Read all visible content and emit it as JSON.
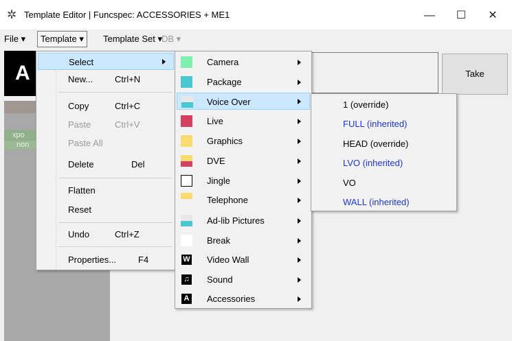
{
  "window": {
    "title": "Template Editor | Funcspec: ACCESSORIES + ME1",
    "icon": "gear-flower-icon",
    "controls": [
      "—",
      "☐",
      "✕"
    ]
  },
  "menubar": {
    "file": "File",
    "template": "Template",
    "template_set": "Template Set",
    "db": "DB"
  },
  "app": {
    "preview_letter": "A",
    "take_label": "Take",
    "row_labels": [
      "xpo",
      "non"
    ]
  },
  "template_menu": {
    "items": [
      {
        "label": "Select",
        "shortcut": "",
        "disabled": false,
        "submenu": true
      },
      {
        "label": "New...",
        "shortcut": "Ctrl+N",
        "disabled": false
      },
      {
        "label": "Copy",
        "shortcut": "Ctrl+C",
        "disabled": false
      },
      {
        "label": "Paste",
        "shortcut": "Ctrl+V",
        "disabled": true
      },
      {
        "label": "Paste All",
        "shortcut": "",
        "disabled": true
      },
      {
        "label": "Delete",
        "shortcut": "Del",
        "disabled": false
      },
      {
        "label": "Flatten",
        "shortcut": "",
        "disabled": false
      },
      {
        "label": "Reset",
        "shortcut": "",
        "disabled": false
      },
      {
        "label": "Undo",
        "shortcut": "Ctrl+Z",
        "disabled": false
      },
      {
        "label": "Properties...",
        "shortcut": "F4",
        "disabled": false
      }
    ]
  },
  "select_menu": {
    "items": [
      {
        "label": "Camera",
        "colors": [
          "#7ef0b0",
          "#7ef0b0"
        ]
      },
      {
        "label": "Package",
        "colors": [
          "#49c8d2",
          "#49c8d2"
        ]
      },
      {
        "label": "Voice Over",
        "colors": [
          "#e8e8e8",
          "#49c8d2"
        ]
      },
      {
        "label": "Live",
        "colors": [
          "#d64060",
          "#d64060"
        ]
      },
      {
        "label": "Graphics",
        "colors": [
          "#f8dc70",
          "#f8dc70"
        ]
      },
      {
        "label": "DVE",
        "colors": [
          "#f8dc70",
          "#d64060"
        ]
      },
      {
        "label": "Jingle",
        "colors": [
          "#ffffff",
          "#ffffff"
        ]
      },
      {
        "label": "Telephone",
        "colors": [
          "#f8dc70",
          "#f2f2f2"
        ]
      },
      {
        "label": "Ad-lib Pictures",
        "colors": [
          "#e8e8e8",
          "#49c8d2"
        ]
      },
      {
        "label": "Break",
        "colors": [
          "#ffffff",
          "#ffffff"
        ]
      },
      {
        "label": "Video Wall",
        "icon": "W"
      },
      {
        "label": "Sound",
        "icon": "♫"
      },
      {
        "label": "Accessories",
        "icon": "A"
      }
    ]
  },
  "voice_over_menu": {
    "items": [
      {
        "label": "1 (override)",
        "inherited": false
      },
      {
        "label": "FULL (inherited)",
        "inherited": true
      },
      {
        "label": "HEAD (override)",
        "inherited": false
      },
      {
        "label": "LVO (inherited)",
        "inherited": true
      },
      {
        "label": "VO",
        "inherited": false
      },
      {
        "label": "WALL (inherited)",
        "inherited": true
      }
    ]
  },
  "colors": {
    "highlight": "#cce8ff",
    "inherited_text": "#1a35d6",
    "disabled_text": "#9a9a9a"
  }
}
